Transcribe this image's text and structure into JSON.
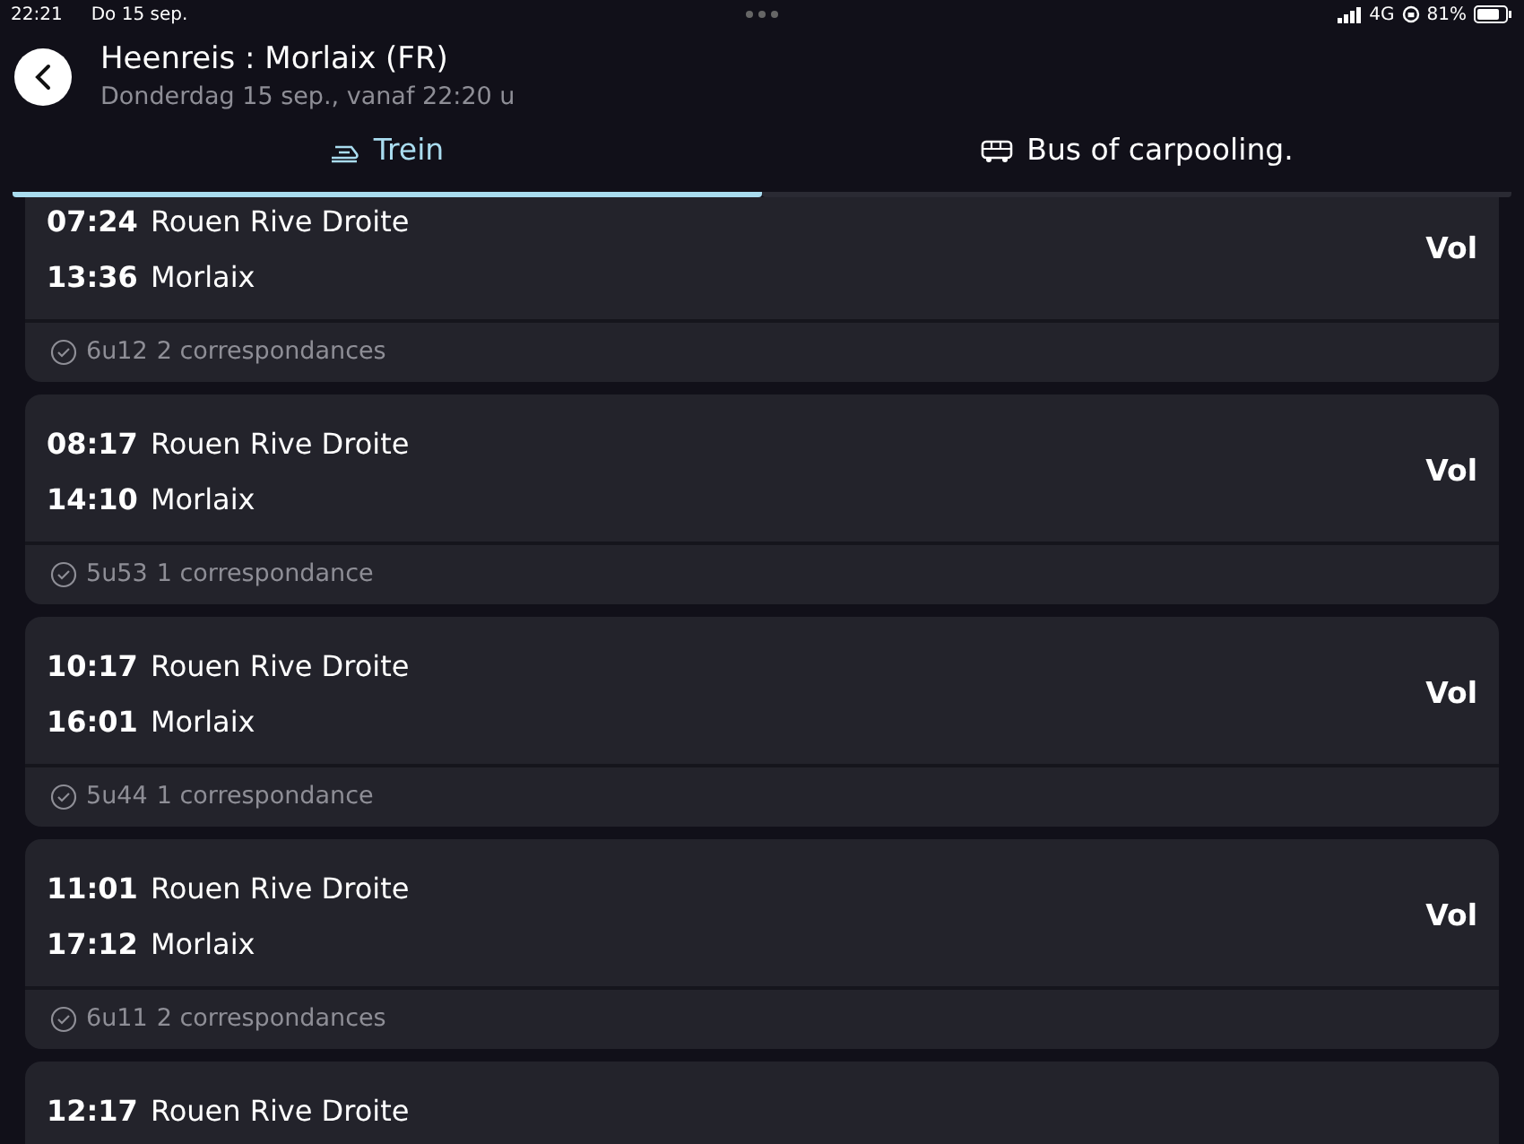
{
  "status_bar": {
    "time": "22:21",
    "date": "Do 15 sep.",
    "network": "4G",
    "battery": "81%"
  },
  "header": {
    "title": "Heenreis : Morlaix (FR)",
    "subtitle": "Donderdag 15 sep., vanaf 22:20 u"
  },
  "tabs": [
    {
      "label": "Trein",
      "kind": "train",
      "selected": true
    },
    {
      "label": "Bus of carpooling.",
      "kind": "bus",
      "selected": false
    }
  ],
  "journeys": [
    {
      "departure_time": "07:24",
      "departure_station": "Rouen Rive Droite",
      "arrival_time": "13:36",
      "arrival_station": "Morlaix",
      "status": "Vol",
      "duration": "6u12",
      "connections": "2 correspondances"
    },
    {
      "departure_time": "08:17",
      "departure_station": "Rouen Rive Droite",
      "arrival_time": "14:10",
      "arrival_station": "Morlaix",
      "status": "Vol",
      "duration": "5u53",
      "connections": "1 correspondance"
    },
    {
      "departure_time": "10:17",
      "departure_station": "Rouen Rive Droite",
      "arrival_time": "16:01",
      "arrival_station": "Morlaix",
      "status": "Vol",
      "duration": "5u44",
      "connections": "1 correspondance"
    },
    {
      "departure_time": "11:01",
      "departure_station": "Rouen Rive Droite",
      "arrival_time": "17:12",
      "arrival_station": "Morlaix",
      "status": "Vol",
      "duration": "6u11",
      "connections": "2 correspondances"
    },
    {
      "departure_time": "12:17",
      "departure_station": "Rouen Rive Droite"
    }
  ]
}
